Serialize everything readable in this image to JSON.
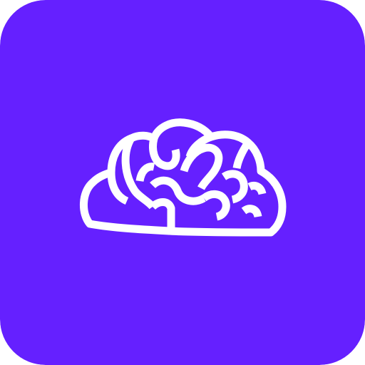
{
  "icon": {
    "name": "brain-icon",
    "background_color": "#6520FF",
    "stroke_color": "#FFFFFF"
  }
}
